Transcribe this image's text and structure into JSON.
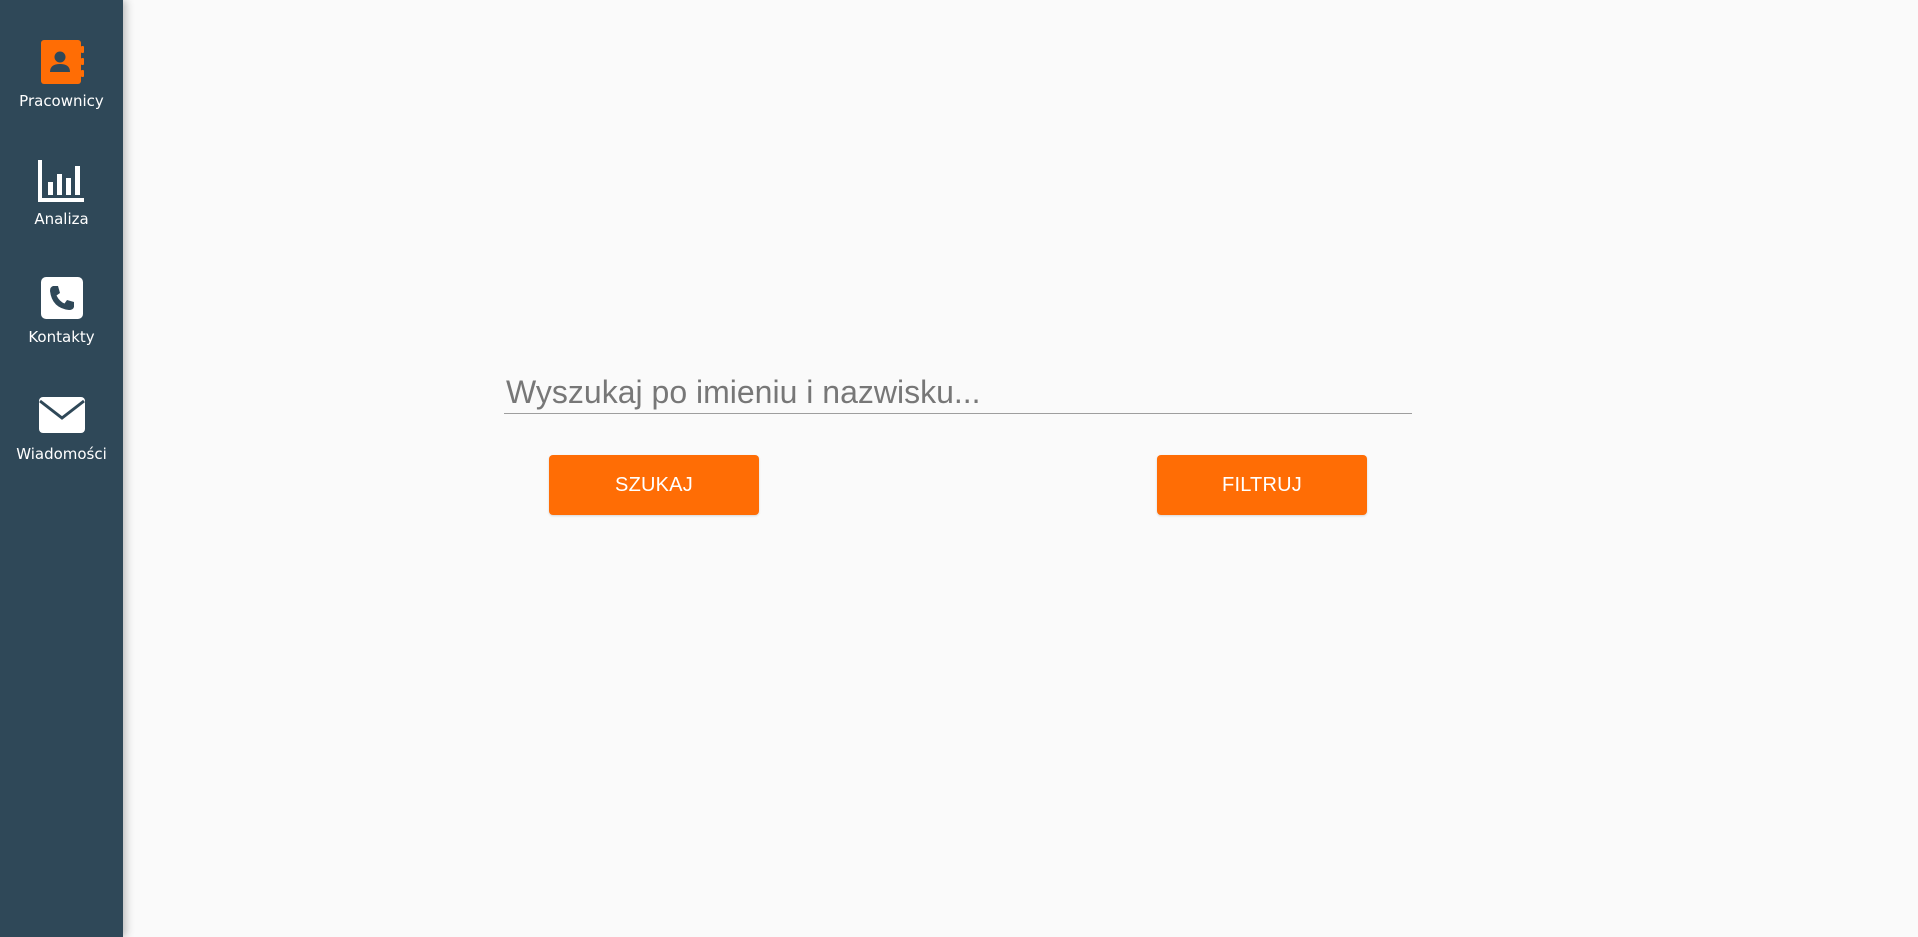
{
  "sidebar": {
    "items": [
      {
        "label": "Pracownicy",
        "icon": "address-book-icon",
        "icon_color": "#ff6d05"
      },
      {
        "label": "Analiza",
        "icon": "bar-chart-icon",
        "icon_color": "#ffffff"
      },
      {
        "label": "Kontakty",
        "icon": "phone-icon",
        "icon_color": "#ffffff"
      },
      {
        "label": "Wiadomości",
        "icon": "envelope-icon",
        "icon_color": "#ffffff"
      }
    ],
    "background": "#2f4858"
  },
  "search": {
    "placeholder": "Wyszukaj po imieniu i nazwisku...",
    "value": ""
  },
  "buttons": {
    "search_label": "SZUKAJ",
    "filter_label": "FILTRUJ",
    "color": "#ff6d05"
  }
}
